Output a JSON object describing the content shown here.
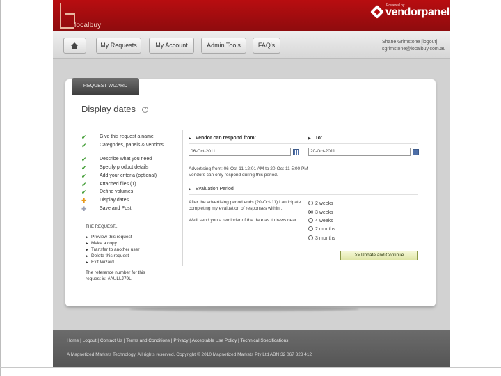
{
  "header": {
    "logo_text": "localbuy",
    "powered_by": "Powered by",
    "brand": "vendorpanel"
  },
  "nav": {
    "items": [
      "My Requests",
      "My Account",
      "Admin Tools",
      "FAQ's"
    ],
    "user_name": "Shane Grimstone [logout]",
    "user_email": "sgrimstone@localbuy.com.au"
  },
  "wizard": {
    "tab": "REQUEST WIZARD",
    "title": "Display dates",
    "help": "?"
  },
  "steps": [
    {
      "label": "Give this request a name",
      "status": "done"
    },
    {
      "label": "Categories, panels & vendors",
      "status": "done"
    },
    {
      "label": "Describe what you need",
      "status": "done"
    },
    {
      "label": "Specify product details",
      "status": "done"
    },
    {
      "label": "Add your criteria (optional)",
      "status": "done"
    },
    {
      "label": "Attached files (1)",
      "status": "done"
    },
    {
      "label": "Define volumes",
      "status": "done"
    },
    {
      "label": "Display dates",
      "status": "current"
    },
    {
      "label": "Save and Post",
      "status": "next"
    }
  ],
  "request_box": {
    "heading": "THE REQUEST...",
    "actions": [
      "Preview this request",
      "Make a copy",
      "Transfer to another user",
      "Delete this request",
      "Exit Wizard"
    ],
    "note": "The reference number for this request is: #AULLJ79L"
  },
  "form": {
    "respond_label": "Vendor can respond from:",
    "to_label": "To:",
    "from_value": "06-Oct-2011",
    "to_value": "20-Oct-2011",
    "advertising_text": "Advertising from: 06-Oct-11 12:01 AM to 20-Oct-11 5:00 PM",
    "vendors_text": "Vendors can only respond during this period.",
    "evaluation_label": "Evaluation Period",
    "evaluation_text_1": "After the advertising period ends (20-Oct-11) I anticipate",
    "evaluation_text_2": "completing my evaluation of responses within...",
    "reminder_text": "We'll send you a reminder of the date as it draws near.",
    "options": [
      "2 weeks",
      "3 weeks",
      "4 weeks",
      "2 months",
      "3 months"
    ],
    "selected_option": "3 weeks",
    "submit_label": ">> Update and Continue"
  },
  "footer": {
    "links": "Home | Logout | Contact Us | Terms and Conditions | Privacy | Acceptable Use Policy | Technical Specifications",
    "copyright": "A Magnetized Markets Technology. All rights reserved. Copyright © 2010 Magnetized Markets Pty Ltd ABN 32 067 323 412"
  },
  "colors": {
    "header_red": "#b80d10",
    "check_green": "#3b9a2e",
    "current_orange": "#e89a1c",
    "footer_gray": "#5f5f5f"
  }
}
